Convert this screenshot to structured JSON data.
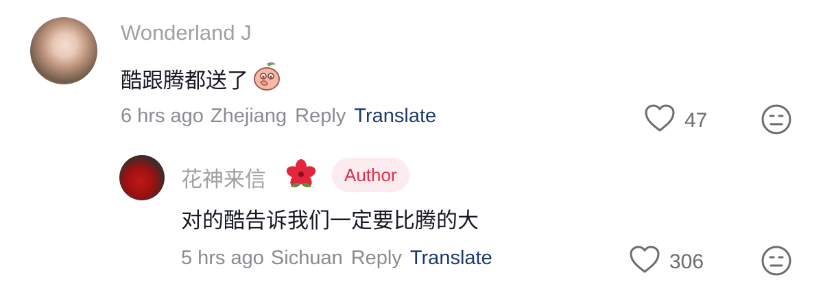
{
  "comments": [
    {
      "username": "Wonderland J",
      "text": "酷跟腾都送了",
      "time": "6 hrs ago",
      "location": "Zhejiang",
      "reply_label": "Reply",
      "translate_label": "Translate",
      "likes": "47"
    },
    {
      "username": "花神来信",
      "badge": "Author",
      "text": "对的酷告诉我们一定要比腾的大",
      "time": "5 hrs ago",
      "location": "Sichuan",
      "reply_label": "Reply",
      "translate_label": "Translate",
      "likes": "306"
    }
  ],
  "colors": {
    "username": "#a0a0a0",
    "translate": "#1d3a6e",
    "author_badge_bg": "#fdecef",
    "author_badge_text": "#e0304e"
  }
}
